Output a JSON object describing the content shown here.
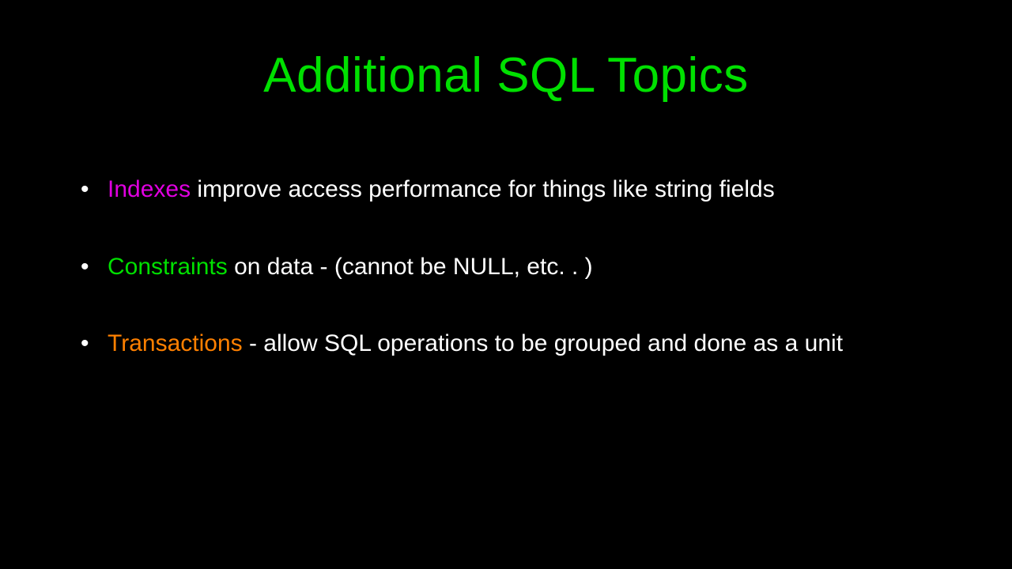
{
  "title": "Additional SQL Topics",
  "bullets": [
    {
      "keyword": "Indexes",
      "rest": " improve access performance for things like string fields",
      "kwClass": "kw-magenta"
    },
    {
      "keyword": "Constraints",
      "rest": " on data - (cannot be NULL, etc. . )",
      "kwClass": "kw-green"
    },
    {
      "keyword": "Transactions",
      "rest": " - allow SQL operations to be grouped and done as a unit",
      "kwClass": "kw-orange"
    }
  ]
}
